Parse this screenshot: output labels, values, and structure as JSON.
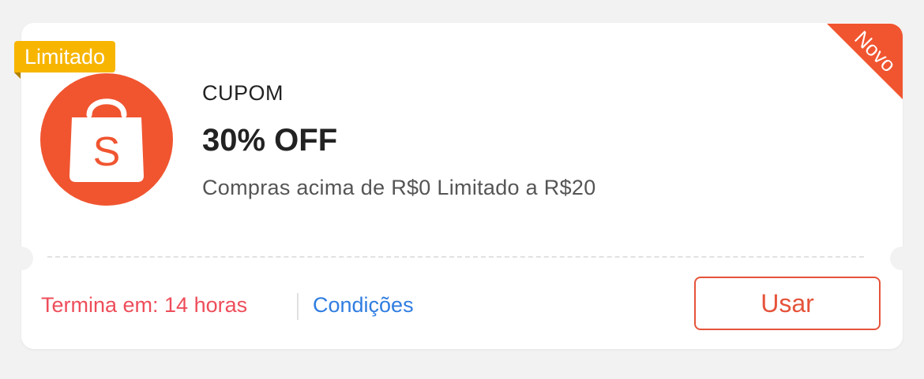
{
  "badges": {
    "limited": "Limitado",
    "new": "Novo"
  },
  "logo": {
    "letter": "S",
    "icon": "shopping-bag-icon",
    "color": "#f05530"
  },
  "coupon": {
    "type": "CUPOM",
    "discount": "30% OFF",
    "condition": "Compras acima de R$0 Limitado a R$20"
  },
  "footer": {
    "expires": "Termina em: 14 horas",
    "conditions_link": "Condições",
    "use_button": "Usar"
  },
  "colors": {
    "brand": "#f05530",
    "limited": "#f7b500",
    "expires": "#ee4d5a",
    "link": "#2f7de1"
  }
}
